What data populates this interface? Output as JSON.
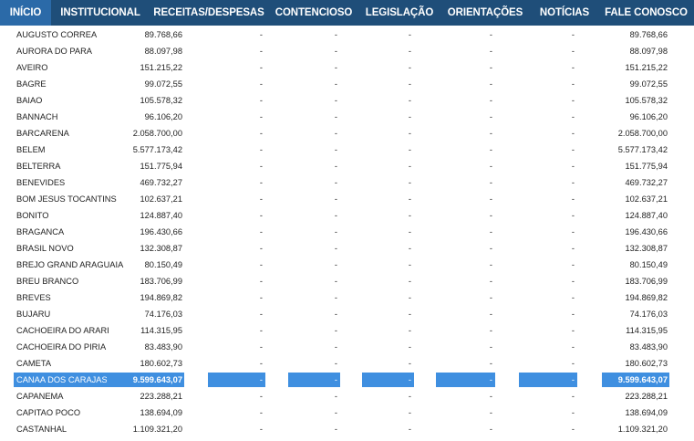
{
  "nav": {
    "items": [
      {
        "label": "INÍCIO",
        "active": true
      },
      {
        "label": "INSTITUCIONAL",
        "active": false
      },
      {
        "label": "RECEITAS/DESPESAS",
        "active": false
      },
      {
        "label": "CONTENCIOSO",
        "active": false
      },
      {
        "label": "LEGISLAÇÃO",
        "active": false
      },
      {
        "label": "ORIENTAÇÕES",
        "active": false
      },
      {
        "label": "NOTÍCIAS",
        "active": false
      },
      {
        "label": "FALE CONOSCO",
        "active": false
      }
    ]
  },
  "colors": {
    "nav_background": "#1f4e79",
    "nav_active": "#2b6aa8",
    "selection_highlight": "#3f8fe0"
  },
  "table": {
    "rows": [
      {
        "name": "AUGUSTO CORREA",
        "value": "89.768,66",
        "c1": "-",
        "c2": "-",
        "c3": "-",
        "c4": "-",
        "c5": "-",
        "total": "89.768,66"
      },
      {
        "name": "AURORA DO PARA",
        "value": "88.097,98",
        "c1": "-",
        "c2": "-",
        "c3": "-",
        "c4": "-",
        "c5": "-",
        "total": "88.097,98"
      },
      {
        "name": "AVEIRO",
        "value": "151.215,22",
        "c1": "-",
        "c2": "-",
        "c3": "-",
        "c4": "-",
        "c5": "-",
        "total": "151.215,22"
      },
      {
        "name": "BAGRE",
        "value": "99.072,55",
        "c1": "-",
        "c2": "-",
        "c3": "-",
        "c4": "-",
        "c5": "-",
        "total": "99.072,55"
      },
      {
        "name": "BAIAO",
        "value": "105.578,32",
        "c1": "-",
        "c2": "-",
        "c3": "-",
        "c4": "-",
        "c5": "-",
        "total": "105.578,32"
      },
      {
        "name": "BANNACH",
        "value": "96.106,20",
        "c1": "-",
        "c2": "-",
        "c3": "-",
        "c4": "-",
        "c5": "-",
        "total": "96.106,20"
      },
      {
        "name": "BARCARENA",
        "value": "2.058.700,00",
        "c1": "-",
        "c2": "-",
        "c3": "-",
        "c4": "-",
        "c5": "-",
        "total": "2.058.700,00"
      },
      {
        "name": "BELEM",
        "value": "5.577.173,42",
        "c1": "-",
        "c2": "-",
        "c3": "-",
        "c4": "-",
        "c5": "-",
        "total": "5.577.173,42"
      },
      {
        "name": "BELTERRA",
        "value": "151.775,94",
        "c1": "-",
        "c2": "-",
        "c3": "-",
        "c4": "-",
        "c5": "-",
        "total": "151.775,94"
      },
      {
        "name": "BENEVIDES",
        "value": "469.732,27",
        "c1": "-",
        "c2": "-",
        "c3": "-",
        "c4": "-",
        "c5": "-",
        "total": "469.732,27"
      },
      {
        "name": "BOM JESUS TOCANTINS",
        "value": "102.637,21",
        "c1": "-",
        "c2": "-",
        "c3": "-",
        "c4": "-",
        "c5": "-",
        "total": "102.637,21"
      },
      {
        "name": "BONITO",
        "value": "124.887,40",
        "c1": "-",
        "c2": "-",
        "c3": "-",
        "c4": "-",
        "c5": "-",
        "total": "124.887,40"
      },
      {
        "name": "BRAGANCA",
        "value": "196.430,66",
        "c1": "-",
        "c2": "-",
        "c3": "-",
        "c4": "-",
        "c5": "-",
        "total": "196.430,66"
      },
      {
        "name": "BRASIL NOVO",
        "value": "132.308,87",
        "c1": "-",
        "c2": "-",
        "c3": "-",
        "c4": "-",
        "c5": "-",
        "total": "132.308,87"
      },
      {
        "name": "BREJO GRAND ARAGUAIA",
        "value": "80.150,49",
        "c1": "-",
        "c2": "-",
        "c3": "-",
        "c4": "-",
        "c5": "-",
        "total": "80.150,49"
      },
      {
        "name": "BREU BRANCO",
        "value": "183.706,99",
        "c1": "-",
        "c2": "-",
        "c3": "-",
        "c4": "-",
        "c5": "-",
        "total": "183.706,99"
      },
      {
        "name": "BREVES",
        "value": "194.869,82",
        "c1": "-",
        "c2": "-",
        "c3": "-",
        "c4": "-",
        "c5": "-",
        "total": "194.869,82"
      },
      {
        "name": "BUJARU",
        "value": "74.176,03",
        "c1": "-",
        "c2": "-",
        "c3": "-",
        "c4": "-",
        "c5": "-",
        "total": "74.176,03"
      },
      {
        "name": "CACHOEIRA DO ARARI",
        "value": "114.315,95",
        "c1": "-",
        "c2": "-",
        "c3": "-",
        "c4": "-",
        "c5": "-",
        "total": "114.315,95"
      },
      {
        "name": "CACHOEIRA DO PIRIA",
        "value": "83.483,90",
        "c1": "-",
        "c2": "-",
        "c3": "-",
        "c4": "-",
        "c5": "-",
        "total": "83.483,90"
      },
      {
        "name": "CAMETA",
        "value": "180.602,73",
        "c1": "-",
        "c2": "-",
        "c3": "-",
        "c4": "-",
        "c5": "-",
        "total": "180.602,73"
      },
      {
        "name": "CANAA DOS CARAJAS",
        "value": "9.599.643,07",
        "c1": "-",
        "c2": "-",
        "c3": "-",
        "c4": "-",
        "c5": "-",
        "total": "9.599.643,07",
        "selected": true
      },
      {
        "name": "CAPANEMA",
        "value": "223.288,21",
        "c1": "-",
        "c2": "-",
        "c3": "-",
        "c4": "-",
        "c5": "-",
        "total": "223.288,21"
      },
      {
        "name": "CAPITAO POCO",
        "value": "138.694,09",
        "c1": "-",
        "c2": "-",
        "c3": "-",
        "c4": "-",
        "c5": "-",
        "total": "138.694,09"
      },
      {
        "name": "CASTANHAL",
        "value": "1.109.321,20",
        "c1": "-",
        "c2": "-",
        "c3": "-",
        "c4": "-",
        "c5": "-",
        "total": "1.109.321,20"
      }
    ]
  }
}
